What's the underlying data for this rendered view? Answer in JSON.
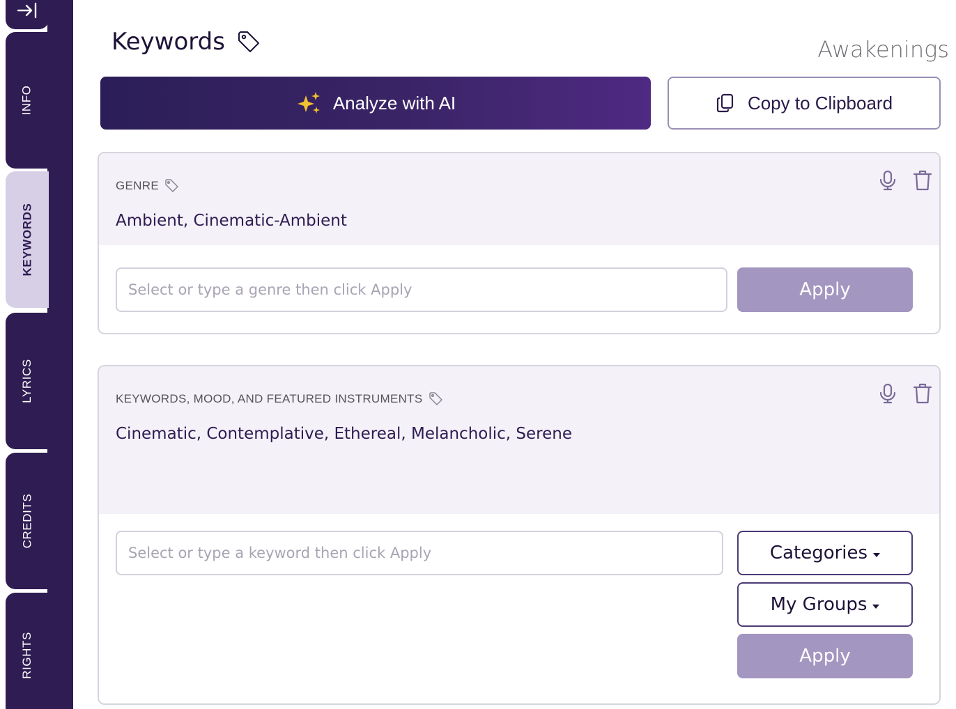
{
  "sidebar": {
    "tabs": [
      {
        "id": "info",
        "label": "INFO"
      },
      {
        "id": "keywords",
        "label": "KEYWORDS"
      },
      {
        "id": "lyrics",
        "label": "LYRICS"
      },
      {
        "id": "credits",
        "label": "CREDITS"
      },
      {
        "id": "rights",
        "label": "RIGHTS"
      }
    ],
    "active_tab": "keywords"
  },
  "header": {
    "title": "Keywords",
    "song_name": "Awakenings"
  },
  "actions": {
    "analyze_label": "Analyze with AI",
    "copy_label": "Copy to Clipboard"
  },
  "genre": {
    "label": "GENRE",
    "values": "Ambient, Cinematic-Ambient",
    "input_placeholder": "Select or type a genre then click Apply",
    "apply_label": "Apply"
  },
  "keywords": {
    "label": "KEYWORDS, MOOD, AND FEATURED INSTRUMENTS",
    "values": "Cinematic, Contemplative, Ethereal, Melancholic, Serene",
    "input_placeholder": "Select or type a keyword then click Apply",
    "categories_label": "Categories",
    "groups_label": "My Groups",
    "apply_label": "Apply"
  },
  "colors": {
    "sidebar": "#2f1c52",
    "active_tab": "#d6cfe6",
    "apply_button": "#a396c0",
    "accent_star": "#f2c230"
  }
}
